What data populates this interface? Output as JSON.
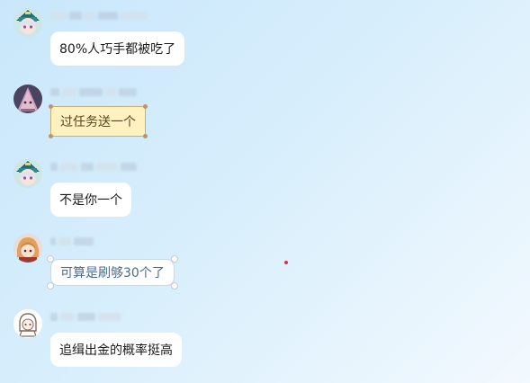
{
  "colors": {
    "background_start": "#c9e7fb",
    "background_end": "#f3f9fe",
    "bubble": "#ffffff",
    "yellow_bubble": "#fdf2c0",
    "red_dot": "#e0303a"
  },
  "messages": [
    {
      "avatar": "anime-girl-teal-hat-avatar",
      "text": "80%人巧手都被吃了",
      "bubble_style": "plain"
    },
    {
      "avatar": "pink-plush-avatar",
      "text": "过任务送一个",
      "bubble_style": "yellow-scroll"
    },
    {
      "avatar": "anime-girl-teal-hat-avatar",
      "text": "不是你一个",
      "bubble_style": "plain"
    },
    {
      "avatar": "orange-hair-character-avatar",
      "text": "可算是刷够30个了",
      "bubble_style": "framed"
    },
    {
      "avatar": "sketch-character-avatar",
      "text": "追缉出金的概率挺高",
      "bubble_style": "plain"
    }
  ]
}
